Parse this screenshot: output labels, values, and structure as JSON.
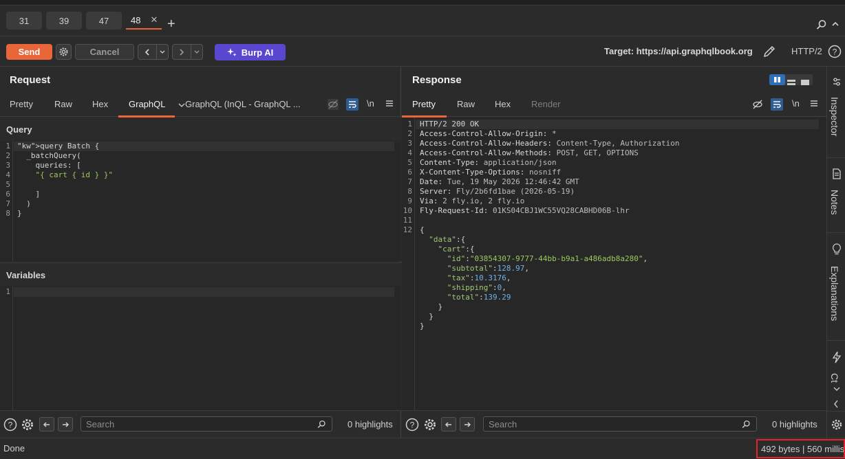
{
  "tabs": [
    {
      "label": "31"
    },
    {
      "label": "39"
    },
    {
      "label": "47"
    },
    {
      "label": "48",
      "active": true
    }
  ],
  "toolbar": {
    "send_label": "Send",
    "cancel_label": "Cancel",
    "burp_ai_label": "Burp AI",
    "target": "Target: https://api.graphqlbook.org",
    "http_version": "HTTP/2"
  },
  "request": {
    "title": "Request",
    "tabs": [
      "Pretty",
      "Raw",
      "Hex",
      "GraphQL",
      "GraphQL (InQL - GraphQL ..."
    ],
    "active_tab": "GraphQL",
    "query_label": "Query",
    "query_lines": [
      "query Batch {",
      "  _batchQuery(",
      "    queries: [",
      "    \"{ cart { id } }\"",
      "",
      "    ]",
      "  )",
      "}"
    ],
    "variables_label": "Variables",
    "variables_lines": [
      ""
    ],
    "search_placeholder": "Search",
    "highlights": "0 highlights"
  },
  "response": {
    "title": "Response",
    "tabs": [
      "Pretty",
      "Raw",
      "Hex",
      "Render"
    ],
    "active_tab": "Pretty",
    "lines": [
      "HTTP/2 200 OK",
      "Access-Control-Allow-Origin: *",
      "Access-Control-Allow-Headers: Content-Type, Authorization",
      "Access-Control-Allow-Methods: POST, GET, OPTIONS",
      "Content-Type: application/json",
      "X-Content-Type-Options: nosniff",
      "Date: Tue, 19 May 2026 12:46:42 GMT",
      "Server: Fly/2b6fd1bae (2026-05-19)",
      "Via: 2 fly.io, 2 fly.io",
      "Fly-Request-Id: 01KS04CBJ1WC55VQ28CABHD06B-lhr",
      "",
      "{",
      "  \"data\":{",
      "    \"cart\":{",
      "      \"id\":\"03854307-9777-44bb-b9a1-a486adb8a280\",",
      "      \"subtotal\":128.97,",
      "      \"tax\":10.3176,",
      "      \"shipping\":0,",
      "      \"total\":139.29",
      "    }",
      "  }",
      "}"
    ],
    "search_placeholder": "Search",
    "highlights": "0 highlights"
  },
  "sidebar": {
    "items": [
      "Inspector",
      "Notes",
      "Explanations",
      "Ct"
    ]
  },
  "status": {
    "done": "Done",
    "bytes": "492 bytes | 560 millis"
  },
  "colors": {
    "accent": "#e8663a",
    "burp_ai": "#5a47cf",
    "highlight_box": "#e0242a"
  }
}
